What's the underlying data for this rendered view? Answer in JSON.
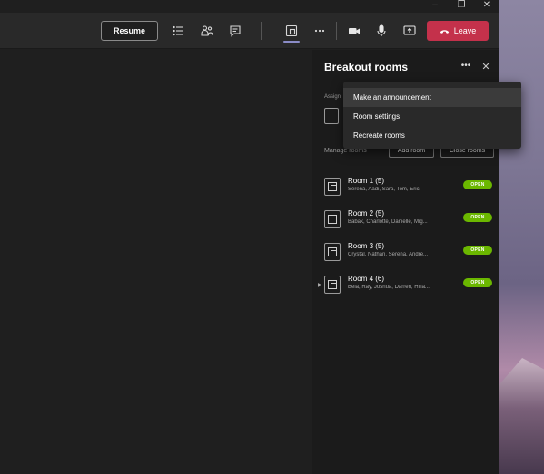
{
  "window": {
    "controls": [
      "–",
      "❐",
      "✕"
    ]
  },
  "toolbar": {
    "resume_label": "Resume",
    "leave_label": "Leave",
    "icons": [
      "participants-list-icon",
      "people-icon",
      "chat-icon",
      "breakout-rooms-icon",
      "more-icon",
      "camera-icon",
      "microphone-icon",
      "share-screen-icon",
      "hang-up-icon"
    ],
    "colors": {
      "leave": "#c4314b",
      "active_indicator": "#8b8cc7"
    }
  },
  "panel": {
    "title": "Breakout rooms",
    "more_glyph": "•••",
    "close_glyph": "✕",
    "assign_label": "Assign",
    "manage_label": "Manage rooms",
    "add_room_label": "Add room",
    "close_rooms_label": "Close rooms",
    "rooms": [
      {
        "name": "Room 1 (5)",
        "members": "Serena, Aadi, Sara, Tom, Eric",
        "status": "OPEN"
      },
      {
        "name": "Room 2 (5)",
        "members": "Babak, Charlotte, Danielle, Mig...",
        "status": "OPEN"
      },
      {
        "name": "Room 3 (5)",
        "members": "Crystal, Nathan, Serena, Andre...",
        "status": "OPEN"
      },
      {
        "name": "Room 4 (6)",
        "members": "Bela, Ray, Joshua, Darren, Hilla...",
        "status": "OPEN"
      }
    ],
    "status_color": "#6bb700"
  },
  "menu": {
    "items": [
      "Make an announcement",
      "Room settings",
      "Recreate rooms"
    ]
  }
}
